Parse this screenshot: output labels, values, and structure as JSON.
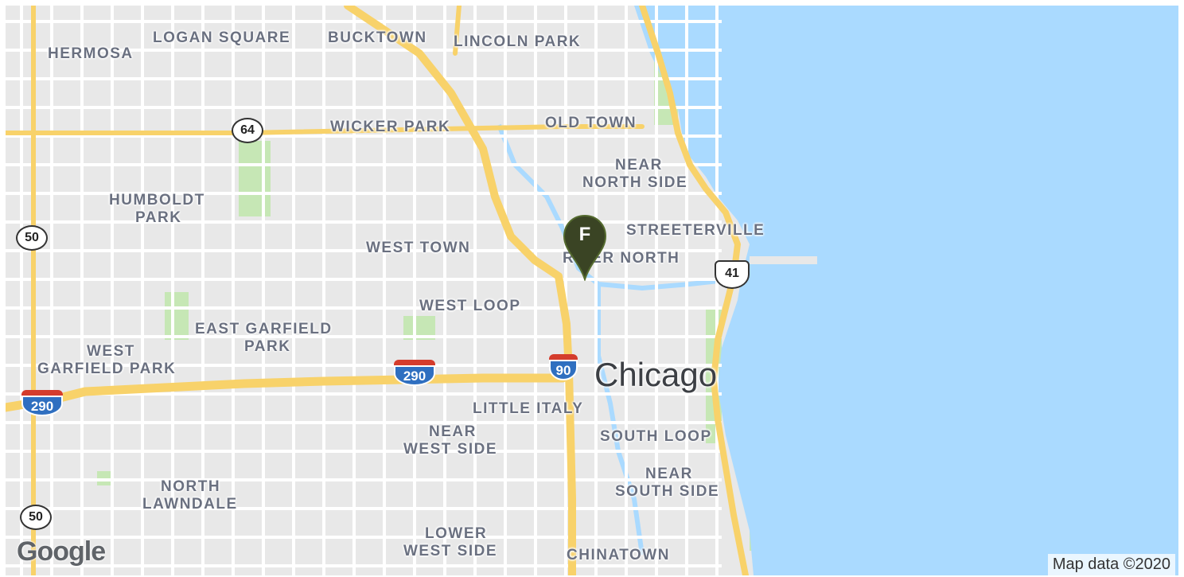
{
  "map": {
    "city_label": "Chicago",
    "neighborhoods": {
      "hermosa": "HERMOSA",
      "logan_square": "LOGAN SQUARE",
      "bucktown": "BUCKTOWN",
      "lincoln_park": "LINCOLN PARK",
      "wicker_park": "WICKER PARK",
      "old_town": "OLD TOWN",
      "near_north_side_1": "NEAR",
      "near_north_side_2": "NORTH SIDE",
      "humboldt_park_1": "HUMBOLDT",
      "humboldt_park_2": "PARK",
      "streeterville": "STREETERVILLE",
      "west_town": "WEST TOWN",
      "river_north": "RIVER NORTH",
      "west_loop": "WEST LOOP",
      "east_garfield_park_1": "EAST GARFIELD",
      "east_garfield_park_2": "PARK",
      "west_garfield_park_1": "WEST",
      "west_garfield_park_2": "GARFIELD PARK",
      "little_italy": "LITTLE ITALY",
      "near_west_side_1": "NEAR",
      "near_west_side_2": "WEST SIDE",
      "south_loop": "SOUTH LOOP",
      "near_south_side_1": "NEAR",
      "near_south_side_2": "SOUTH SIDE",
      "north_lawndale_1": "NORTH",
      "north_lawndale_2": "LAWNDALE",
      "lower_west_side_1": "LOWER",
      "lower_west_side_2": "WEST SIDE",
      "chinatown": "CHINATOWN"
    },
    "shields": {
      "us64": "64",
      "us50_top": "50",
      "us50_bottom": "50",
      "us41": "41",
      "i290_west": "290",
      "i290_center": "290",
      "i90": "90"
    },
    "marker_letter": "F",
    "logo_text": "Google",
    "attribution": "Map data ©2020"
  },
  "colors": {
    "water": "#aadaff",
    "land": "#e8e8e8",
    "highway": "#f8d26a",
    "park": "#c6e7b5",
    "marker": "#3a4424"
  }
}
